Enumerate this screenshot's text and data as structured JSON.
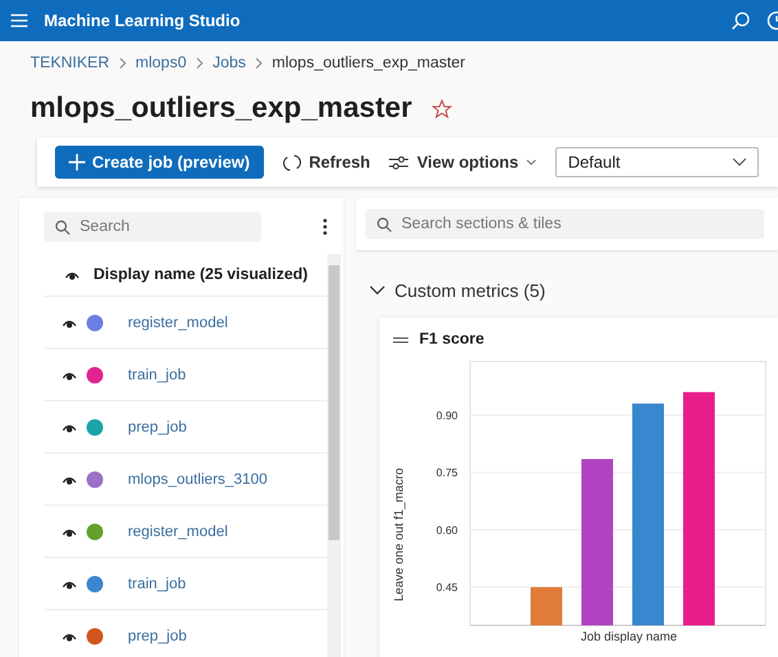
{
  "app_bar": {
    "title": "Machine Learning Studio"
  },
  "breadcrumb": [
    "TEKNIKER",
    "mlops0",
    "Jobs",
    "mlops_outliers_exp_master"
  ],
  "page_title": "mlops_outliers_exp_master",
  "favorite": false,
  "toolbar": {
    "create_button": "Create job (preview)",
    "refresh_button": "Refresh",
    "view_options": "View options",
    "view_select": "Default"
  },
  "runs_panel": {
    "search": {
      "placeholder": "Search"
    },
    "header": "Display name (25 visualized)",
    "runs": [
      {
        "name": "register_model",
        "color": "#6b7fe3"
      },
      {
        "name": "train_job",
        "color": "#e3238f"
      },
      {
        "name": "prep_job",
        "color": "#1aa3a8"
      },
      {
        "name": "mlops_outliers_3100",
        "color": "#9c6fc9"
      },
      {
        "name": "register_model",
        "color": "#64a02e"
      },
      {
        "name": "train_job",
        "color": "#3a86cf"
      },
      {
        "name": "prep_job",
        "color": "#d2561c"
      }
    ]
  },
  "dashboard": {
    "search": {
      "placeholder": "Search sections & tiles"
    },
    "section": {
      "title": "Custom metrics (5)",
      "expanded": true
    },
    "tile": {
      "title": "F1 score",
      "chart_data": {
        "type": "bar",
        "grid": true,
        "xlabel": "Job display name",
        "ylabel": "Leave one out f1_macro",
        "ylim": [
          0.35,
          1.04
        ],
        "yticks": [
          {
            "value": 0.45,
            "label": "0.45"
          },
          {
            "value": 0.6,
            "label": "0.60"
          },
          {
            "value": 0.75,
            "label": "0.75"
          },
          {
            "value": 0.9,
            "label": "0.90"
          }
        ],
        "series": [
          {
            "color": "#e07b39",
            "values": [
              0.45
            ]
          },
          {
            "color": "#b044c0",
            "values": [
              0.785
            ]
          },
          {
            "color": "#3a86cf",
            "values": [
              0.93
            ]
          },
          {
            "color": "#e91e8c",
            "values": [
              0.96
            ]
          }
        ]
      }
    }
  }
}
